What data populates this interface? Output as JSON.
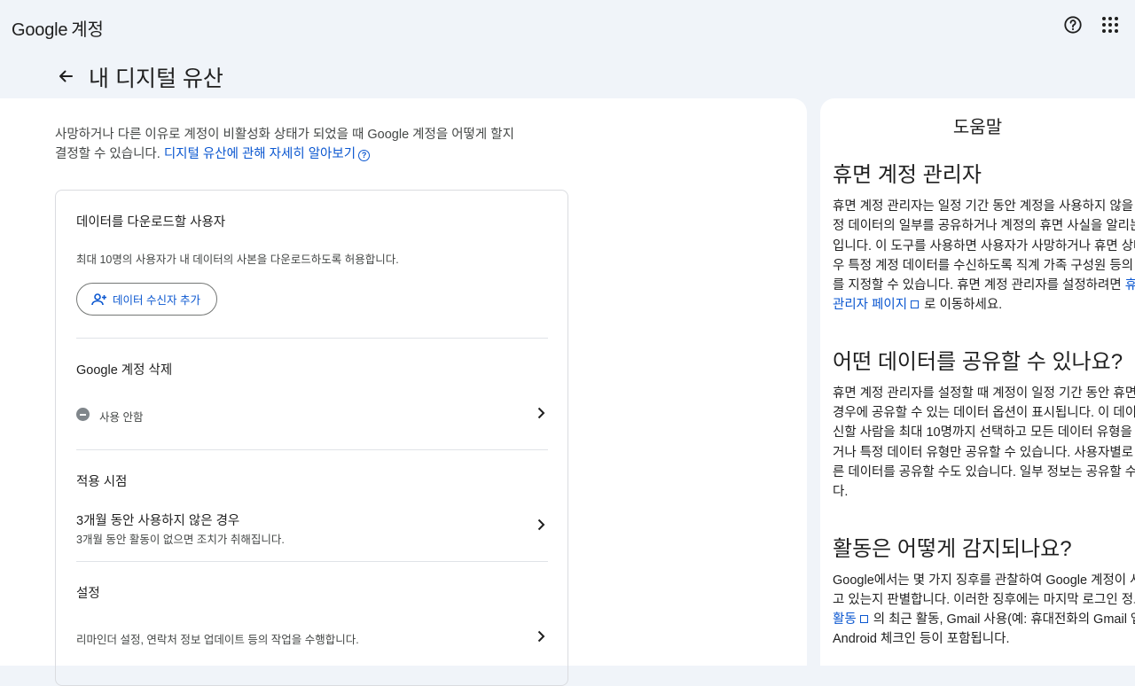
{
  "header": {
    "logo_brand": "Google",
    "logo_product": "계정",
    "help_icon": "help-circle-icon",
    "apps_icon": "apps-grid-icon"
  },
  "page": {
    "title": "내 디지털 유산",
    "back_icon": "arrow-back-icon"
  },
  "intro": {
    "line1": "사망하거나 다른 이유로 계정이 비활성화 상태가 되었을 때 Google 계정을 어떻게 할지",
    "line2": "결정할 수 있습니다.",
    "link": "디지털 유산에 관해 자세히 알아보기"
  },
  "sections": {
    "download": {
      "title": "데이터를 다운로드할 사용자",
      "desc": "최대 10명의 사용자가 내 데이터의 사본을 다운로드하도록 허용합니다.",
      "button": "데이터 수신자 추가"
    },
    "delete": {
      "title": "Google 계정 삭제",
      "status": "사용 안함"
    },
    "timing": {
      "title": "적용 시점",
      "row_title": "3개월 동안 사용하지 않은 경우",
      "row_desc": "3개월 동안 활동이 없으면 조치가 취해집니다."
    },
    "settings": {
      "title": "설정",
      "desc": "리마인더 설정, 연락처 정보 업데이트 등의 작업을 수행합니다."
    }
  },
  "help": {
    "heading": "도움말",
    "h1": "휴면 계정 관리자",
    "p1": [
      "휴면 계정 관리자는 일정 기간 동안 계정을 사용하지 않을 경",
      "정 데이터의 일부를 공유하거나 계정의 휴면 사실을 알리는",
      "입니다. 이 도구를 사용하면 사용자가 사망하거나 휴면 상태",
      "우 특정 계정 데이터를 수신하도록 직계 가족 구성원 등의 제",
      "를 지정할 수 있습니다. 휴면 계정 관리자를 설정하려면"
    ],
    "p1_link_a": "휴면",
    "p1_link_b": "관리자 페이지",
    "p1_tail": "로 이동하세요.",
    "h2": "어떤 데이터를 공유할 수 있나요?",
    "p2": [
      "휴면 계정 관리자를 설정할 때 계정이 일정 기간 동안 휴면 상",
      "경우에 공유할 수 있는 데이터 옵션이 표시됩니다. 이 데이터",
      "신할 사람을 최대 10명까지 선택하고 모든 데이터 유형을 공",
      "거나 특정 데이터 유형만 공유할 수 있습니다. 사용자별로 서",
      "른 데이터를 공유할 수도 있습니다. 일부 정보는 공유할 수 없",
      "다."
    ],
    "h3": "활동은 어떻게 감지되나요?",
    "p3": [
      "Google에서는 몇 가지 징후를 관찰하여 Google 계정이 사",
      "고 있는지 판별합니다. 이러한 징후에는 마지막 로그인 정보"
    ],
    "p3_link": "활동",
    "p3_line3_tail": "의 최근 활동, Gmail 사용(예: 휴대전화의 Gmail 앱",
    "p3_line4": "Android 체크인 등이 포함됩니다."
  }
}
